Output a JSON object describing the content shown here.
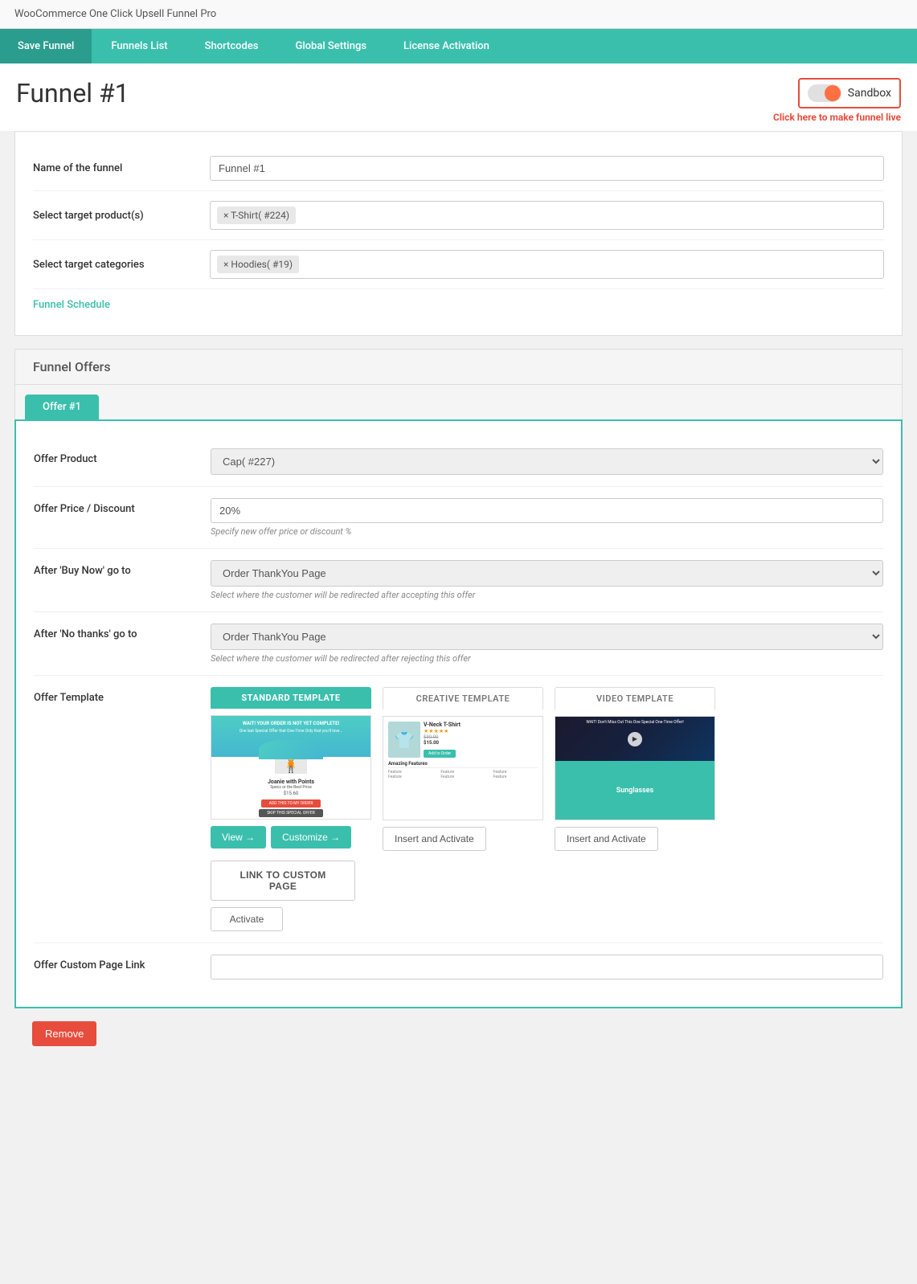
{
  "app": {
    "title": "WooCommerce One Click Upsell Funnel Pro"
  },
  "nav": {
    "items": [
      {
        "label": "Save Funnel",
        "active": true
      },
      {
        "label": "Funnels List",
        "active": false
      },
      {
        "label": "Shortcodes",
        "active": false
      },
      {
        "label": "Global Settings",
        "active": false
      },
      {
        "label": "License Activation",
        "active": false
      }
    ]
  },
  "page": {
    "title": "Funnel #1",
    "sandbox_label": "Sandbox",
    "make_live_text": "Click here to make funnel live"
  },
  "funnel_settings": {
    "name_label": "Name of the funnel",
    "name_value": "Funnel #1",
    "target_products_label": "Select target product(s)",
    "target_product_tag": "× T-Shirt( #224)",
    "target_categories_label": "Select target categories",
    "target_category_tag": "× Hoodies( #19)",
    "schedule_label": "Funnel Schedule"
  },
  "funnel_offers": {
    "section_title": "Funnel Offers",
    "offer_tab_label": "Offer #1",
    "offer_product_label": "Offer Product",
    "offer_product_value": "Cap( #227)",
    "offer_price_label": "Offer Price / Discount",
    "offer_price_value": "20%",
    "offer_price_hint": "Specify new offer price or discount %",
    "buy_now_label": "After 'Buy Now' go to",
    "buy_now_value": "Order ThankYou Page",
    "buy_now_hint": "Select where the customer will be redirected after accepting this offer",
    "no_thanks_label": "After 'No thanks' go to",
    "no_thanks_value": "Order ThankYou Page",
    "no_thanks_hint": "Select where the customer will be redirected after rejecting this offer",
    "offer_template_label": "Offer Template",
    "templates": [
      {
        "id": "standard",
        "header": "STANDARD TEMPLATE",
        "active": true,
        "btn1_label": "View →",
        "btn2_label": "Customize →"
      },
      {
        "id": "creative",
        "header": "CREATIVE TEMPLATE",
        "active": false,
        "product_name": "V-Neck T-Shirt",
        "old_price": "$30.00",
        "new_price": "$15.00",
        "features_title": "Amazing Features",
        "btn_insert": "Insert and Activate"
      },
      {
        "id": "video",
        "header": "VIDEO TEMPLATE",
        "product_name": "Sunglasses",
        "btn_insert": "Insert and Activate"
      }
    ],
    "custom_page_btn_label": "LINK TO CUSTOM PAGE",
    "activate_btn_label": "Activate",
    "offer_custom_page_link_label": "Offer Custom Page Link",
    "remove_btn_label": "Remove"
  }
}
